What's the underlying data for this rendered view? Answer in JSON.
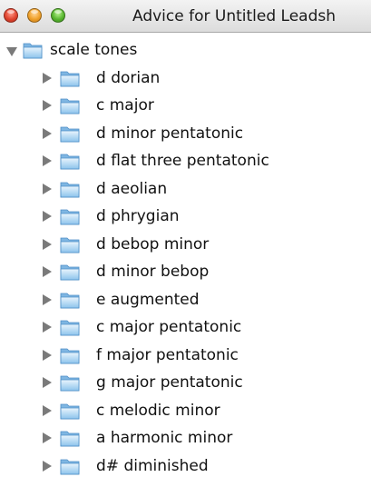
{
  "window": {
    "title": "Advice for Untitled Leadsh"
  },
  "icons": {
    "close": "close-button-red",
    "minimize": "minimize-button-yellow",
    "zoom": "zoom-button-green",
    "folder": "folder-icon",
    "expanded": "triangle-down-icon",
    "collapsed": "triangle-right-icon"
  },
  "tree": {
    "root_label": "scale tones",
    "children": [
      "d dorian",
      "c major",
      "d minor pentatonic",
      "d flat three pentatonic",
      "d aeolian",
      "d phrygian",
      "d bebop minor",
      "d minor bebop",
      "e augmented",
      "c major pentatonic",
      "f major pentatonic",
      "g major pentatonic",
      "c melodic minor",
      "a harmonic minor",
      "d# diminished"
    ]
  },
  "colors": {
    "folder_light": "#d6ecfb",
    "folder_dark": "#6fb1e3"
  }
}
